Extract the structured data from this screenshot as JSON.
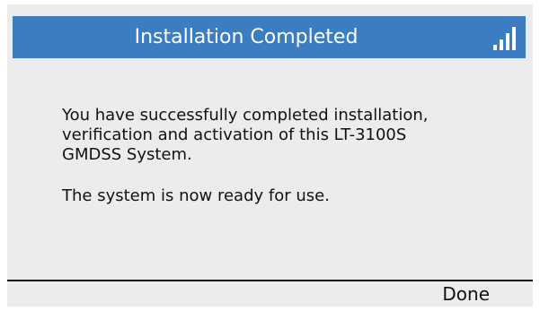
{
  "dialog": {
    "title": "Installation Completed",
    "message_line_1": "You have successfully completed installation,\nverification and activation of this LT-3100S\nGMDSS System.",
    "message_line_2": "The system is now ready for use."
  },
  "softkeys": {
    "done_label": "Done"
  },
  "status": {
    "signal_icon": "signal-strength-icon",
    "signal_level_bars": 4,
    "signal_max_bars": 4
  },
  "colors": {
    "title_bar": "#3b7dc0",
    "screen_background": "#ececec",
    "text": "#111111"
  }
}
